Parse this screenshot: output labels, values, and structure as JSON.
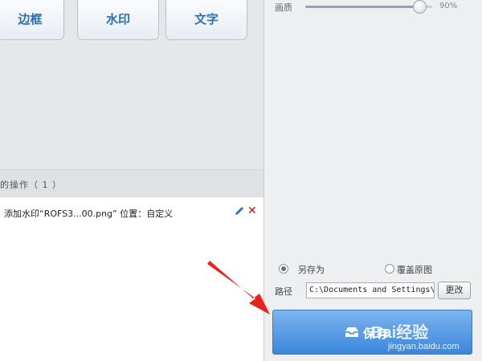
{
  "toolbar": {
    "border_label": "边框",
    "watermark_label": "水印",
    "text_label": "文字"
  },
  "operations": {
    "header": "的操作（ 1 ）",
    "items": [
      {
        "text": "添加水印“ROFS3...00.png” 位置：自定义",
        "edit_icon": "pencil-icon",
        "delete_icon": "close-icon"
      }
    ]
  },
  "settings": {
    "quality_label": "画质",
    "quality_value": "90%",
    "quality_level": 0.9,
    "save_as_label": "另存为",
    "overwrite_label": "覆盖原图",
    "selected_option": "另存为",
    "path_label": "路径",
    "path_value": "C:\\Documents and Settings\\",
    "change_label": "更改",
    "save_label": "保存",
    "save_icon": "inbox-icon"
  },
  "watermark": {
    "brand": "Bai经验",
    "site": "jingyan.baidu.com"
  },
  "colors": {
    "accent": "#3b86dc",
    "label_blue": "#2b6fb5",
    "delete_red": "#c1121c",
    "arrow_red": "#e8231d"
  }
}
